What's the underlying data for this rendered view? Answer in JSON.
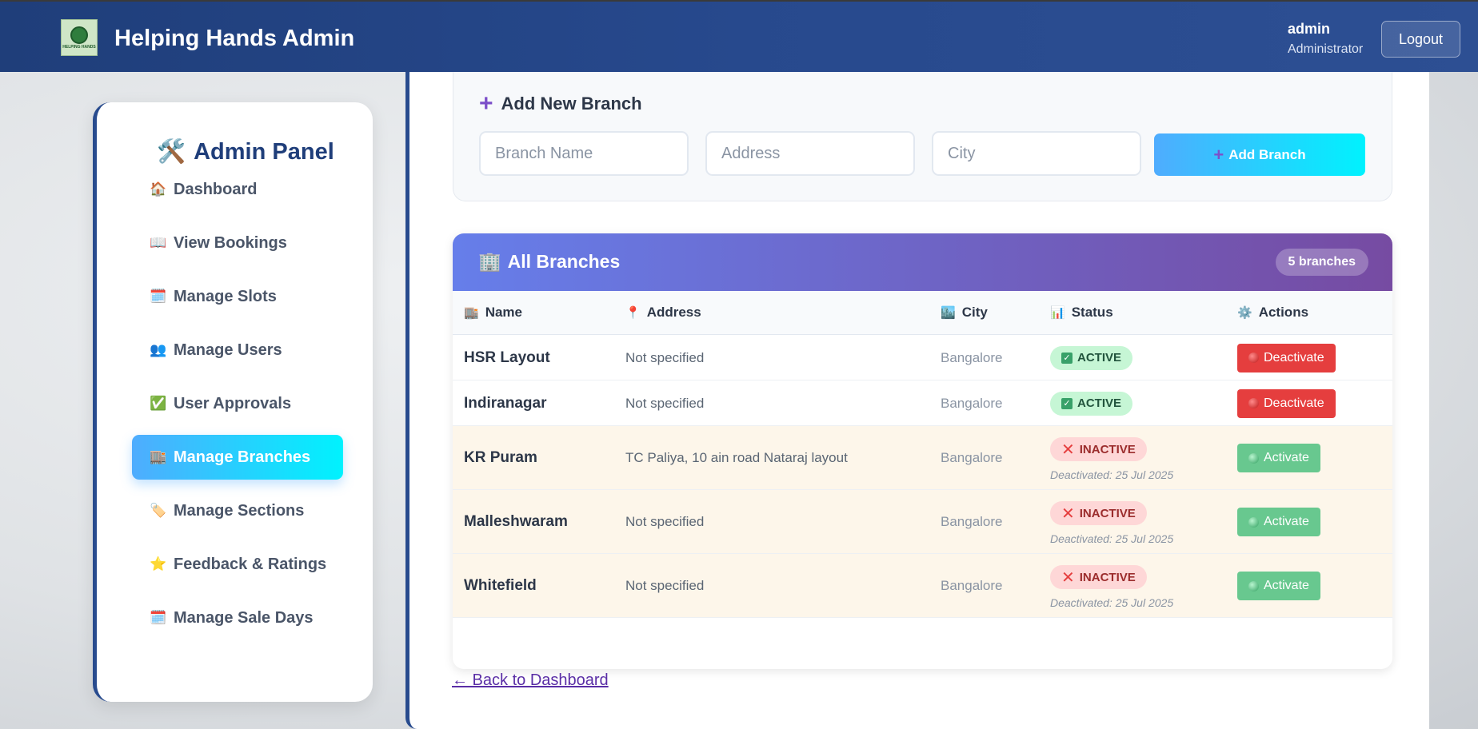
{
  "header": {
    "app_title": "Helping Hands Admin",
    "logo_text": "HELPING HANDS",
    "user_name": "admin",
    "user_role": "Administrator",
    "logout_label": "Logout"
  },
  "sidebar": {
    "title": "Admin Panel",
    "title_icon": "🛠️",
    "items": [
      {
        "label": "Dashboard",
        "icon": "🏠",
        "icon_name": "house-icon"
      },
      {
        "label": "View Bookings",
        "icon": "📖",
        "icon_name": "book-icon"
      },
      {
        "label": "Manage Slots",
        "icon": "🗓️",
        "icon_name": "calendar-icon"
      },
      {
        "label": "Manage Users",
        "icon": "👥",
        "icon_name": "users-icon"
      },
      {
        "label": "User Approvals",
        "icon": "✅",
        "icon_name": "check-icon"
      },
      {
        "label": "Manage Branches",
        "icon": "🏬",
        "icon_name": "building-icon",
        "active": true
      },
      {
        "label": "Manage Sections",
        "icon": "🏷️",
        "icon_name": "tag-icon"
      },
      {
        "label": "Feedback & Ratings",
        "icon": "⭐",
        "icon_name": "star-icon"
      },
      {
        "label": "Manage Sale Days",
        "icon": "🗓️",
        "icon_name": "calendar-icon"
      }
    ]
  },
  "add_branch": {
    "title": "Add New Branch",
    "name_placeholder": "Branch Name",
    "address_placeholder": "Address",
    "city_placeholder": "City",
    "button_label": "Add Branch"
  },
  "branches": {
    "title": "All Branches",
    "title_icon": "🏢",
    "count_label": "5 branches",
    "columns": [
      {
        "label": "Name",
        "icon": "🏬"
      },
      {
        "label": "Address",
        "icon": "📍"
      },
      {
        "label": "City",
        "icon": "🏙️"
      },
      {
        "label": "Status",
        "icon": "📊"
      },
      {
        "label": "Actions",
        "icon": "⚙️"
      }
    ],
    "rows": [
      {
        "name": "HSR Layout",
        "address": "Not specified",
        "city": "Bangalore",
        "status": "ACTIVE",
        "note": "",
        "action": "Deactivate"
      },
      {
        "name": "Indiranagar",
        "address": "Not specified",
        "city": "Bangalore",
        "status": "ACTIVE",
        "note": "",
        "action": "Deactivate"
      },
      {
        "name": "KR Puram",
        "address": "TC Paliya, 10 ain road Nataraj layout",
        "city": "Bangalore",
        "status": "INACTIVE",
        "note": "Deactivated: 25 Jul 2025",
        "action": "Activate"
      },
      {
        "name": "Malleshwaram",
        "address": "Not specified",
        "city": "Bangalore",
        "status": "INACTIVE",
        "note": "Deactivated: 25 Jul 2025",
        "action": "Activate"
      },
      {
        "name": "Whitefield",
        "address": "Not specified",
        "city": "Bangalore",
        "status": "INACTIVE",
        "note": "Deactivated: 25 Jul 2025",
        "action": "Activate"
      }
    ]
  },
  "back_link": "← Back to Dashboard",
  "colors": {
    "header": "#27498d",
    "accent_gradient_start": "#4facfe",
    "accent_gradient_end": "#00f2fe",
    "table_header_start": "#667eea",
    "table_header_end": "#764ba2",
    "danger": "#e53e3e",
    "success": "#68c88f"
  }
}
